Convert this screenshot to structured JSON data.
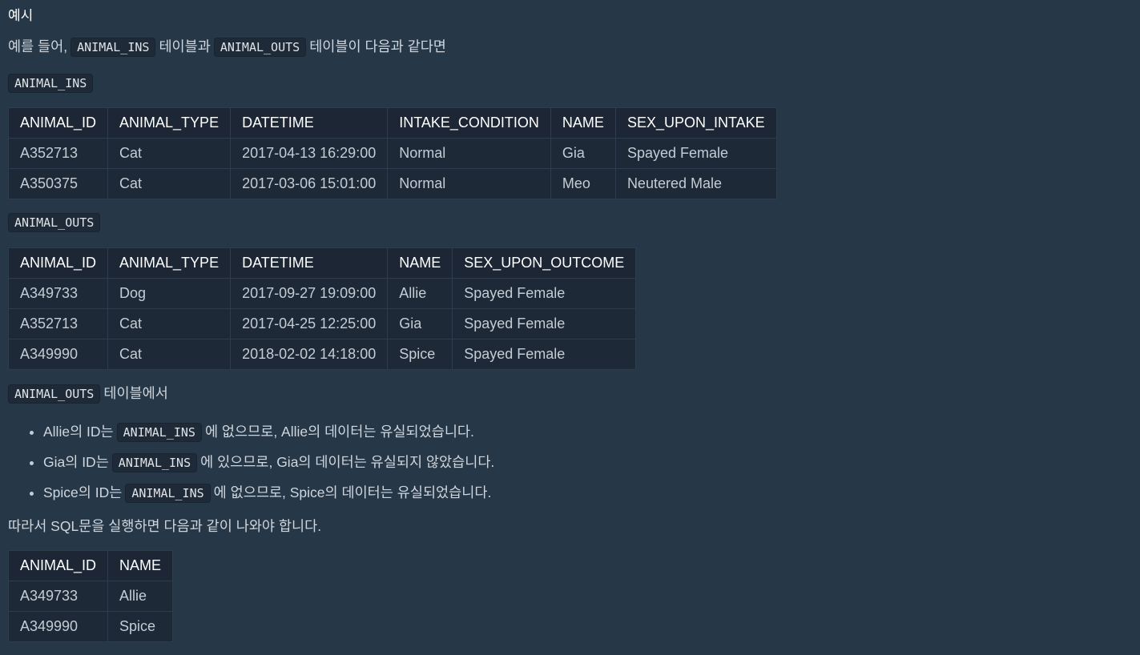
{
  "heading": "예시",
  "intro": {
    "prefix": "예를 들어,",
    "code1": "ANIMAL_INS",
    "mid": "테이블과",
    "code2": "ANIMAL_OUTS",
    "suffix": "테이블이 다음과 같다면"
  },
  "ins_tag": "ANIMAL_INS",
  "ins_table": {
    "headers": [
      "ANIMAL_ID",
      "ANIMAL_TYPE",
      "DATETIME",
      "INTAKE_CONDITION",
      "NAME",
      "SEX_UPON_INTAKE"
    ],
    "rows": [
      [
        "A352713",
        "Cat",
        "2017-04-13 16:29:00",
        "Normal",
        "Gia",
        "Spayed Female"
      ],
      [
        "A350375",
        "Cat",
        "2017-03-06 15:01:00",
        "Normal",
        "Meo",
        "Neutered Male"
      ]
    ]
  },
  "outs_tag": "ANIMAL_OUTS",
  "outs_table": {
    "headers": [
      "ANIMAL_ID",
      "ANIMAL_TYPE",
      "DATETIME",
      "NAME",
      "SEX_UPON_OUTCOME"
    ],
    "rows": [
      [
        "A349733",
        "Dog",
        "2017-09-27 19:09:00",
        "Allie",
        "Spayed Female"
      ],
      [
        "A352713",
        "Cat",
        "2017-04-25 12:25:00",
        "Gia",
        "Spayed Female"
      ],
      [
        "A349990",
        "Cat",
        "2018-02-02 14:18:00",
        "Spice",
        "Spayed Female"
      ]
    ]
  },
  "explain": {
    "code": "ANIMAL_OUTS",
    "text": "테이블에서"
  },
  "bullets": [
    {
      "before": "Allie의 ID는",
      "code": "ANIMAL_INS",
      "after": "에 없으므로, Allie의 데이터는 유실되었습니다."
    },
    {
      "before": "Gia의 ID는",
      "code": "ANIMAL_INS",
      "after": "에 있으므로, Gia의 데이터는 유실되지 않았습니다."
    },
    {
      "before": "Spice의 ID는",
      "code": "ANIMAL_INS",
      "after": "에 없으므로, Spice의 데이터는 유실되었습니다."
    }
  ],
  "conclusion": "따라서 SQL문을 실행하면 다음과 같이 나와야 합니다.",
  "result_table": {
    "headers": [
      "ANIMAL_ID",
      "NAME"
    ],
    "rows": [
      [
        "A349733",
        "Allie"
      ],
      [
        "A349990",
        "Spice"
      ]
    ]
  }
}
